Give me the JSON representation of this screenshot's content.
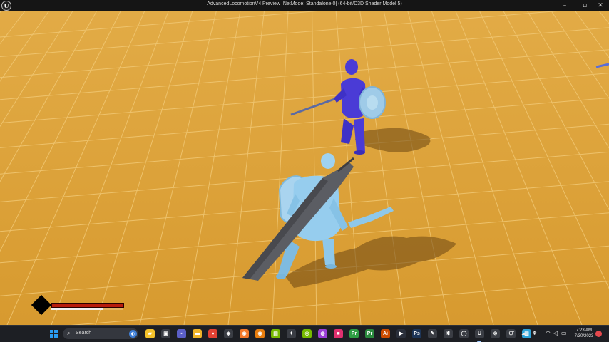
{
  "window": {
    "title": "AdvancedLocomotionV4 Preview [NetMode: Standalone 0]  (64-bit/D3D Shader Model 5)",
    "app_icon": "unreal-engine-logo",
    "logo_letter": "U",
    "controls": {
      "minimize": "–",
      "maximize": "▫",
      "close": "✕"
    }
  },
  "hud": {
    "health_fraction": 1.0,
    "stamina_fraction": 0.72,
    "health_color": "#b71c0d",
    "stamina_color": "#f2f2f2"
  },
  "scene": {
    "floor_color": "#dca23a",
    "enemy_color": "#4a3bd6",
    "player_color": "#8ec8ea",
    "greatsword_color": "#5b5d63"
  },
  "taskbar": {
    "search_label": "Search",
    "search_icon": "magnifier-icon",
    "apps": [
      {
        "name": "file-explorer-icon",
        "color": "#f3c12a",
        "glyph": "▰"
      },
      {
        "name": "task-view-icon",
        "color": "#3a3d44",
        "glyph": "▣"
      },
      {
        "name": "teams-icon",
        "color": "#5b5fc7",
        "glyph": "▪"
      },
      {
        "name": "folder-icon",
        "color": "#f0b429",
        "glyph": "▬"
      },
      {
        "name": "chrome-icon",
        "color": "#e34133",
        "glyph": "●"
      },
      {
        "name": "unity-icon",
        "color": "#3a3d44",
        "glyph": "◈"
      },
      {
        "name": "blender-icon",
        "color": "#f5792a",
        "glyph": "◉"
      },
      {
        "name": "blender-alt-icon",
        "color": "#e87d0d",
        "glyph": "◉"
      },
      {
        "name": "nvidia-icon",
        "color": "#76b900",
        "glyph": "▤"
      },
      {
        "name": "gear-app-icon",
        "color": "#3a3d44",
        "glyph": "✦"
      },
      {
        "name": "geforce-icon",
        "color": "#76b900",
        "glyph": "◎"
      },
      {
        "name": "purple-app-icon",
        "color": "#9b3fd6",
        "glyph": "◍"
      },
      {
        "name": "pink-app-icon",
        "color": "#e0306f",
        "glyph": "■"
      },
      {
        "name": "pr-icon",
        "color": "#2f9e44",
        "glyph": "Pr"
      },
      {
        "name": "ae-icon",
        "color": "#2b8a3e",
        "glyph": "Pr"
      },
      {
        "name": "illustrator-icon",
        "color": "#cc4b00",
        "glyph": "Ai"
      },
      {
        "name": "media-icon",
        "color": "#2a2f3a",
        "glyph": "▶"
      },
      {
        "name": "photoshop-icon",
        "color": "#1d3557",
        "glyph": "Ps"
      },
      {
        "name": "edit-icon",
        "color": "#3a3d44",
        "glyph": "✎"
      },
      {
        "name": "davinci-icon",
        "color": "#3a3d44",
        "glyph": "❋"
      },
      {
        "name": "obs-icon",
        "color": "#3a3d44",
        "glyph": "◯"
      },
      {
        "name": "unreal-taskbar-icon",
        "color": "#3a3d44",
        "glyph": "U"
      },
      {
        "name": "steam-icon",
        "color": "#3a3d44",
        "glyph": "⊚"
      },
      {
        "name": "misc-app-icon",
        "color": "#3a3d44",
        "glyph": "⎔"
      },
      {
        "name": "notes-icon",
        "color": "#2fa4d8",
        "glyph": "▥"
      }
    ],
    "tray": {
      "chevron_icon": "chevron-up-icon",
      "clock_time": "7:23 AM",
      "clock_date": "7/30/2023"
    }
  }
}
